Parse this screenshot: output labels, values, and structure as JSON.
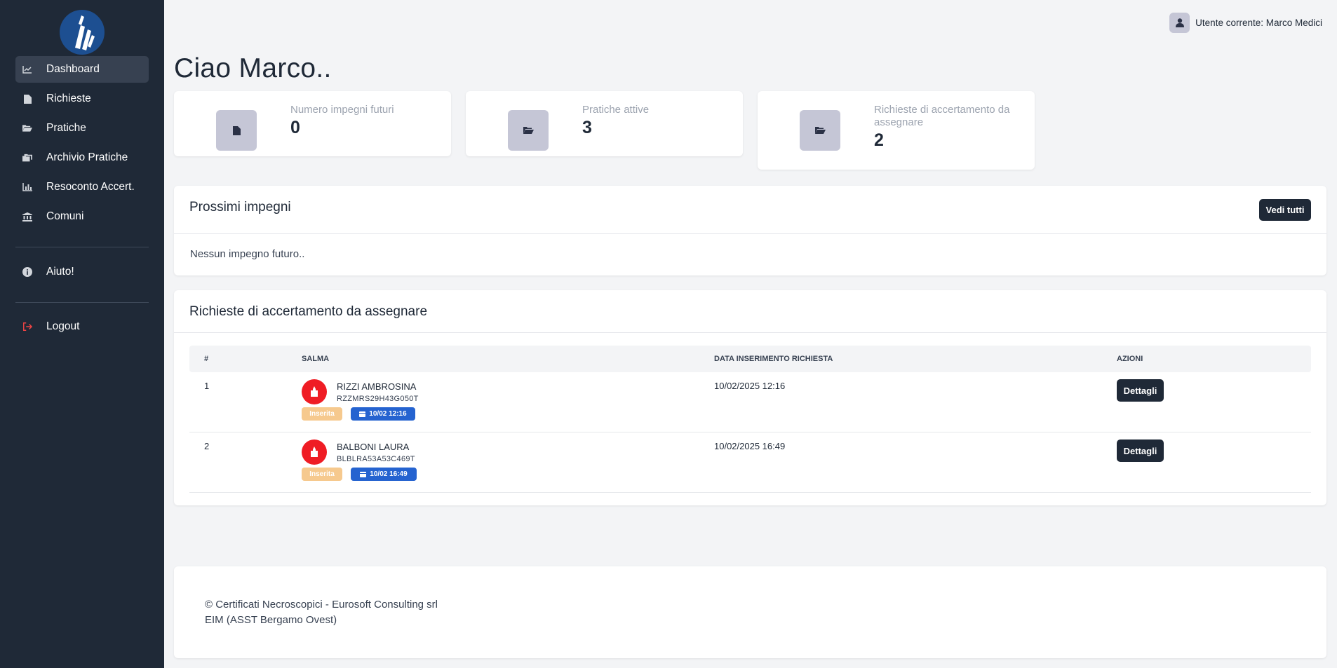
{
  "sidebar": {
    "items": [
      {
        "label": "Dashboard",
        "icon": "chart-line-icon",
        "active": true
      },
      {
        "label": "Richieste",
        "icon": "file-icon"
      },
      {
        "label": "Pratiche",
        "icon": "folder-open-icon"
      },
      {
        "label": "Archivio Pratiche",
        "icon": "folders-icon"
      },
      {
        "label": "Resoconto Accert.",
        "icon": "bar-chart-icon"
      },
      {
        "label": "Comuni",
        "icon": "building-columns-icon"
      }
    ],
    "help": {
      "label": "Aiuto!",
      "icon": "info-icon"
    },
    "logout": {
      "label": "Logout",
      "icon": "logout-icon"
    }
  },
  "header": {
    "user": "Utente corrente: Marco Medici"
  },
  "greeting": "Ciao Marco..",
  "stats": [
    {
      "title": "Numero impegni futuri",
      "value": "0",
      "icon": "file-icon"
    },
    {
      "title": "Pratiche attive",
      "value": "3",
      "icon": "folder-open-icon"
    },
    {
      "title": "Richieste di accertamento da assegnare",
      "value": "2",
      "icon": "folder-open-icon"
    }
  ],
  "upcoming": {
    "title": "Prossimi impegni",
    "button": "Vedi tutti",
    "empty": "Nessun impegno futuro.."
  },
  "requests": {
    "title": "Richieste di accertamento da assegnare",
    "columns": [
      "#",
      "SALMA",
      "DATA INSERIMENTO RICHIESTA",
      "AZIONI"
    ],
    "rows": [
      {
        "num": "1",
        "name": "RIZZI AMBROSINA",
        "code": "RZZMRS29H43G050T",
        "status": "Inserita",
        "date_badge": "10/02 12:16",
        "date": "10/02/2025 12:16",
        "action": "Dettagli"
      },
      {
        "num": "2",
        "name": "BALBONI LAURA",
        "code": "BLBLRA53A53C469T",
        "status": "Inserita",
        "date_badge": "10/02 16:49",
        "date": "10/02/2025 16:49",
        "action": "Dettagli"
      }
    ]
  },
  "footer": {
    "line1": "© Certificati Necroscopici - Eurosoft Consulting srl",
    "line2": "EIM (ASST Bergamo Ovest)"
  },
  "colors": {
    "sidebar": "#1f2937",
    "accent_dark": "#1f2937",
    "badge_inserted": "#f6c98e",
    "badge_date": "#2563d0",
    "avatar_red": "#ef1c24",
    "logout_icon": "#ef4444"
  }
}
